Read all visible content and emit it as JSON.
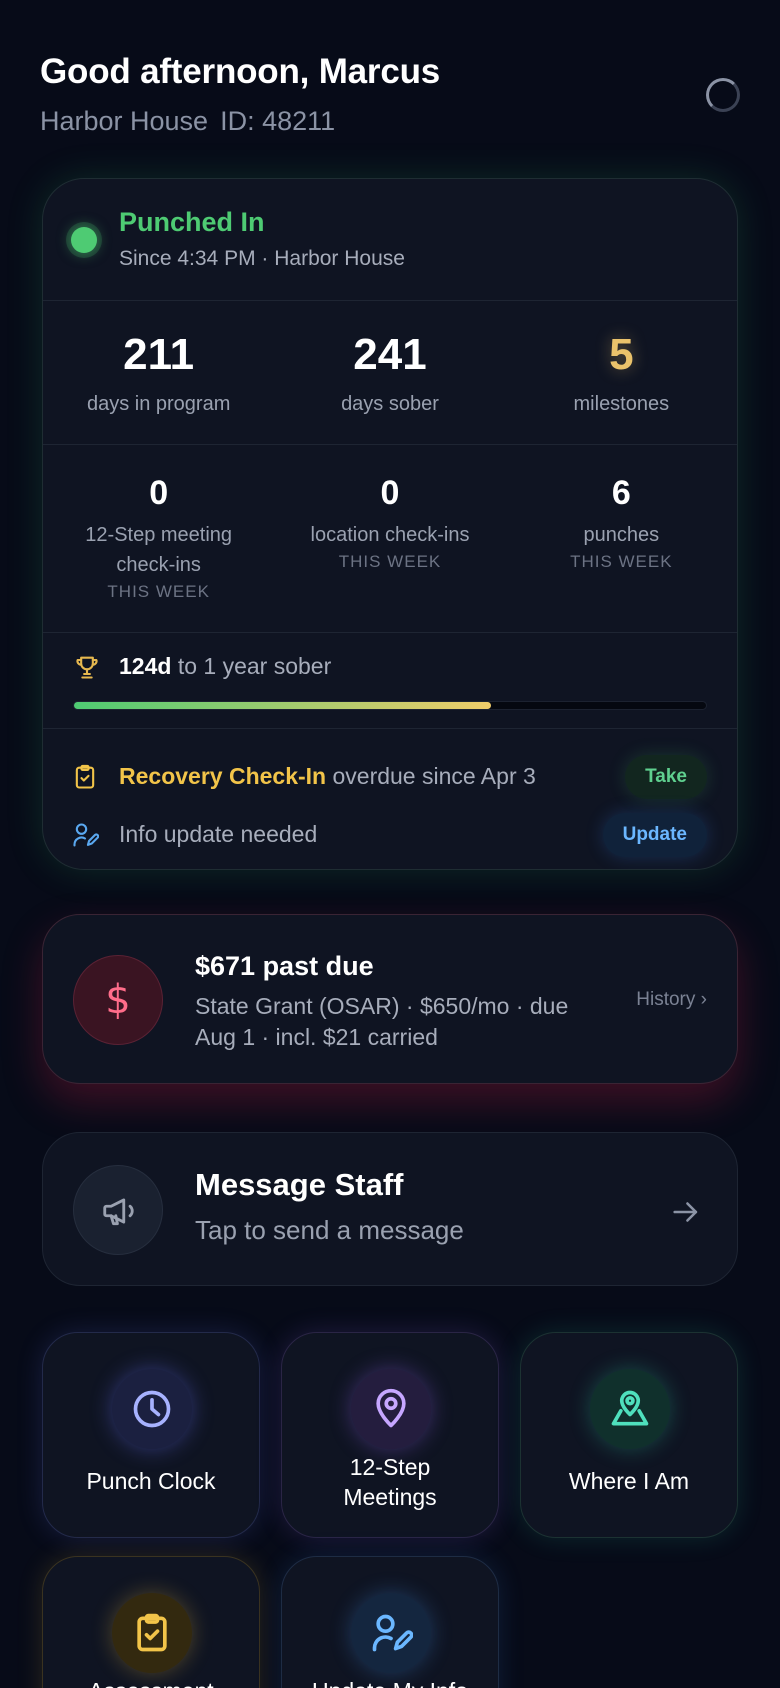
{
  "header": {
    "greeting": "Good afternoon, Marcus",
    "house": "Harbor House",
    "member_id": "ID: 48211"
  },
  "status": {
    "title": "Punched In",
    "subtitle": "Since 4:34 PM · Harbor House",
    "stats_primary": [
      {
        "value": "211",
        "label": "days in program"
      },
      {
        "value": "241",
        "label": "days sober"
      },
      {
        "value": "5",
        "label": "milestones"
      }
    ],
    "stats_weekly": [
      {
        "value": "0",
        "label_line1": "12-Step meeting",
        "label_line2": "check-ins",
        "period": "THIS WEEK"
      },
      {
        "value": "0",
        "label_line1": "location check-ins",
        "period": "THIS WEEK"
      },
      {
        "value": "6",
        "label_line1": "punches",
        "period": "THIS WEEK"
      }
    ],
    "goal": {
      "days_left": "124d",
      "text": "to 1 year sober",
      "progress_fraction": 0.66
    },
    "alerts": {
      "checkin_highlight": "Recovery Check-In",
      "checkin_text": "overdue since Apr 3",
      "checkin_action": "Take",
      "info_text": "Info update needed",
      "info_action": "Update"
    }
  },
  "billing": {
    "title": "$671 past due",
    "detail_line1": "State Grant (OSAR) · $650/mo · due",
    "detail_line2": "Aug 1 · incl. $21 carried",
    "link": "History ›",
    "icon_glyph": "$"
  },
  "message": {
    "title": "Message Staff",
    "subtitle": "Tap to send a message"
  },
  "tiles": [
    {
      "line1": "Punch Clock",
      "icon": "clock-icon"
    },
    {
      "line1": "12-Step",
      "line2": "Meetings",
      "icon": "map-pin-icon"
    },
    {
      "line1": "Where I Am",
      "icon": "map-location-icon"
    },
    {
      "line1": "Assessment",
      "icon": "clipboard-check-icon"
    },
    {
      "line1": "Update My Info",
      "icon": "user-edit-icon"
    }
  ],
  "colors": {
    "background": "#070b18",
    "card": "#0f1422",
    "accent_green": "#4ecb73",
    "accent_gold": "#eac26b",
    "accent_yellow": "#f2c449",
    "accent_blue": "#6bb7ff",
    "accent_red": "#ff6d8a"
  }
}
